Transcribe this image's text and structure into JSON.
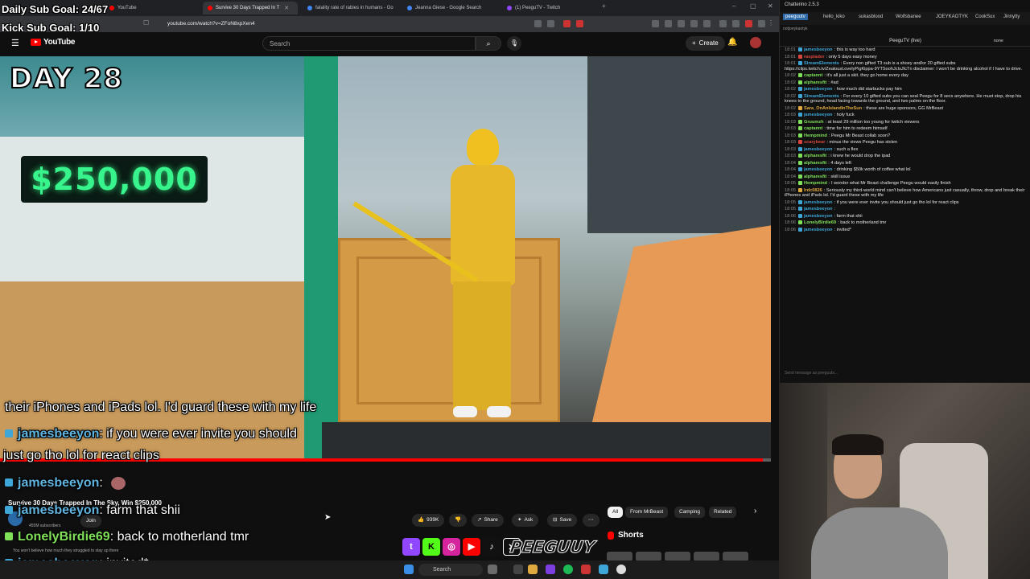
{
  "browser": {
    "tabs": [
      {
        "label": "YouTube",
        "active": false
      },
      {
        "label": "Survive 30 Days Trapped In T",
        "active": true
      },
      {
        "label": "fatality rate of rabies in humans - Go",
        "active": false
      },
      {
        "label": "Jeanna Giese - Google Search",
        "active": false
      },
      {
        "label": "(1) PeeguTV - Twitch",
        "active": false
      }
    ],
    "url": "youtube.com/watch?v=ZFoN8xpXen4"
  },
  "overlay_goals": {
    "daily": "Daily Sub Goal: 24/67",
    "kick": "Kick Sub Goal: 1/10"
  },
  "youtube": {
    "logo": "YouTube",
    "search_placeholder": "Search",
    "create_label": "Create",
    "video_day_label": "DAY 28",
    "money_display": "$250,000",
    "progress": 0.99,
    "title": "Survive 30 Days Trapped In The Sky, Win $250,000",
    "actions": {
      "likes": "939K",
      "share": "Share",
      "ask": "Ask",
      "save": "Save"
    },
    "chips": [
      "All",
      "From MrBeast",
      "Camping",
      "Related"
    ],
    "shorts_label": "Shorts",
    "channel_subs": "455M subscribers",
    "join": "Join",
    "description_snippet": "You won't believe how much they struggled to stay up there"
  },
  "video_overlay_chat": {
    "line1": "their iPhones and iPads lol. I'd guard these with my life",
    "msg2_user": "jamesbeeyon",
    "msg2_text": ": if you were ever invite you should",
    "msg2_cont": "just go tho lol for react clips",
    "msg3_user": "jamesbeeyon",
    "msg3_text": ":",
    "msg4_user": "jamesbeeyon",
    "msg4_text": ": farm that shii",
    "msg5_user": "LonelyBirdie69",
    "msg5_text": ": back to motherland tmr",
    "msg6_user": "jamesbeeyon",
    "msg6_text": ": invited*"
  },
  "stream_brand": "PEEGUUY",
  "taskbar": {
    "search": "Search"
  },
  "chatterino": {
    "title": "Chatterino 2.5.3",
    "tabs": [
      "peeguutv",
      "hello_kiko",
      "sukasblood",
      "Wolfsbanee",
      "JOEYKAOTYK",
      "CookSux",
      "Jinnytty"
    ],
    "split_label": "notjoeykaotyk",
    "channel": "PeeguTV (live)",
    "mode": "none",
    "input_placeholder": "Send message as peeguutv...",
    "messages": [
      {
        "time": "18:01",
        "user": "jamesbeeyon",
        "color": "#3fa6d8",
        "text": "this is way too hard"
      },
      {
        "time": "18:01",
        "user": "raspiador",
        "color": "#d8473f",
        "text": "only 5 days easy money"
      },
      {
        "time": "18:01",
        "user": "StreamElements",
        "color": "#3fa6d8",
        "text": "Every non gifted T3 sub is a shoey and/or 20 gifted subs https://clips.twitch.tv/ZealousLovelyPigKippa-9YTSoohJcIsJIcTn disclaimer: I won't be drinking alcohol if I have to drive."
      },
      {
        "time": "18:02",
        "user": "captannt",
        "color": "#7fe05a",
        "text": "it's all just a skit. they go home every day"
      },
      {
        "time": "18:02",
        "user": "alpharesfit",
        "color": "#7fe05a",
        "text": "#ad"
      },
      {
        "time": "18:02",
        "user": "jamesbeeyon",
        "color": "#3fa6d8",
        "text": "how much did starbucks pay him"
      },
      {
        "time": "18:02",
        "user": "StreamElements",
        "color": "#3fa6d8",
        "text": "For every 10 gifted subs you can seal Peegu for 8 secs anywhere. He must stop, drop his knees to the ground, head facing towards the ground, and two palms on the floor."
      },
      {
        "time": "18:02",
        "user": "Sara_OnAnIslandInTheSun",
        "color": "#e0a93f",
        "text": "these are huge sponsors, GG MrBeast"
      },
      {
        "time": "18:03",
        "user": "jamesbeeyon",
        "color": "#3fa6d8",
        "text": "holy fuck"
      },
      {
        "time": "18:03",
        "user": "Gruumzh",
        "color": "#7fe05a",
        "text": "at least 29 million too young for twitch viewers"
      },
      {
        "time": "18:03",
        "user": "captannt",
        "color": "#7fe05a",
        "text": "time for him to redeem himself"
      },
      {
        "time": "18:03",
        "user": "Hempmind",
        "color": "#7fe05a",
        "text": "Peegu Mr Beast collab soon?"
      },
      {
        "time": "18:03",
        "user": "scarybear",
        "color": "#d8473f",
        "text": "minus the views Peegu has stolen"
      },
      {
        "time": "18:03",
        "user": "jamesbeeyon",
        "color": "#3fa6d8",
        "text": "such a flex"
      },
      {
        "time": "18:03",
        "user": "alpharesfit",
        "color": "#7fe05a",
        "text": "i knew he would drop the ipad"
      },
      {
        "time": "18:04",
        "user": "alpharesfit",
        "color": "#7fe05a",
        "text": "4 days left"
      },
      {
        "time": "18:04",
        "user": "jamesbeeyon",
        "color": "#3fa6d8",
        "text": "drinking $50k worth of coffee what lol"
      },
      {
        "time": "18:04",
        "user": "alpharesfit",
        "color": "#7fe05a",
        "text": "skill issue"
      },
      {
        "time": "18:05",
        "user": "Hempmind",
        "color": "#7fe05a",
        "text": "I wonder what Mr Beast challenge Peegu would easily finish"
      },
      {
        "time": "18:05",
        "user": "lrdc0826",
        "color": "#e0a93f",
        "text": "Seriously my third-world mind can't believe how Americans just casually, throw, drop and break their iPhones and iPads lol. I'd guard these with my life"
      },
      {
        "time": "18:05",
        "user": "jamesbeeyon",
        "color": "#3fa6d8",
        "text": "if you were ever invite you should just go tho lol for react clips"
      },
      {
        "time": "18:05",
        "user": "jamesbeeyon",
        "color": "#3fa6d8",
        "text": ""
      },
      {
        "time": "18:06",
        "user": "jamesbeeyon",
        "color": "#3fa6d8",
        "text": "farm that shii"
      },
      {
        "time": "18:06",
        "user": "LonelyBirdie69",
        "color": "#7fe05a",
        "text": "back to motherland tmr"
      },
      {
        "time": "18:06",
        "user": "jamesbeeyon",
        "color": "#3fa6d8",
        "text": "invited*"
      }
    ]
  }
}
